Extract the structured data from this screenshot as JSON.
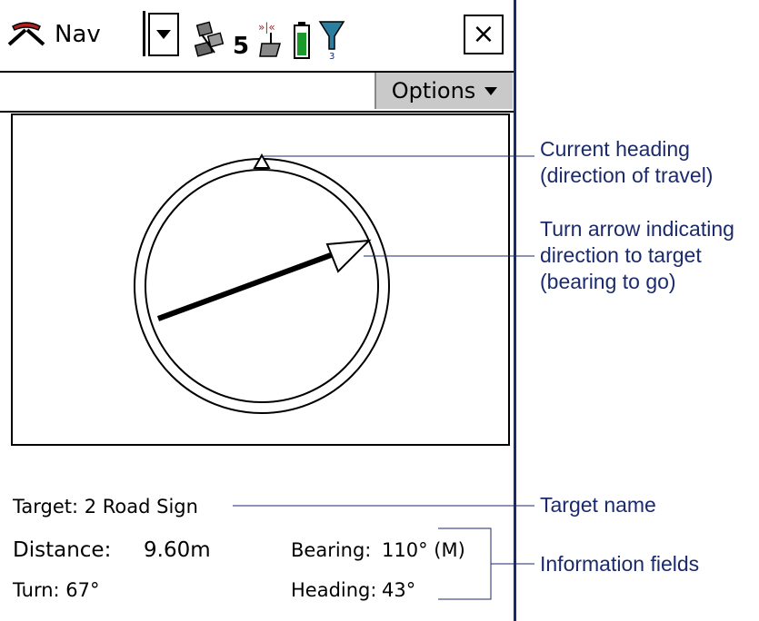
{
  "titlebar": {
    "app_label": "Nav",
    "satellite_count": "5",
    "close_label": "×"
  },
  "menubar": {
    "options_label": "Options"
  },
  "fields": {
    "target_label": "Target:",
    "target_value": "2 Road Sign",
    "distance_label": "Distance:",
    "distance_value": "9.60m",
    "bearing_label": "Bearing:",
    "bearing_value": "110° (M)",
    "turn_label": "Turn:",
    "turn_value": "67°",
    "heading_label": "Heading:",
    "heading_value": "43°"
  },
  "callouts": {
    "current_heading_line1": "Current heading",
    "current_heading_line2": "(direction of travel)",
    "turn_arrow_line1": "Turn arrow indicating",
    "turn_arrow_line2": "direction to target",
    "turn_arrow_line3": "(bearing to go)",
    "target_name": "Target name",
    "information_fields": "Information fields"
  },
  "icons": {
    "nav": "pickaxe-icon",
    "dropdown": "triangle-down-icon",
    "satellite": "satellite-icon",
    "base_station": "radio-tower-icon",
    "battery": "battery-icon",
    "filter": "filter-icon"
  },
  "colors": {
    "annotation": "#1b2a6b",
    "battery_fill": "#1a9a2a",
    "filter": "#2a7fa0",
    "menu_button": "#c9c9c9",
    "nav_icon": "#b02020"
  }
}
